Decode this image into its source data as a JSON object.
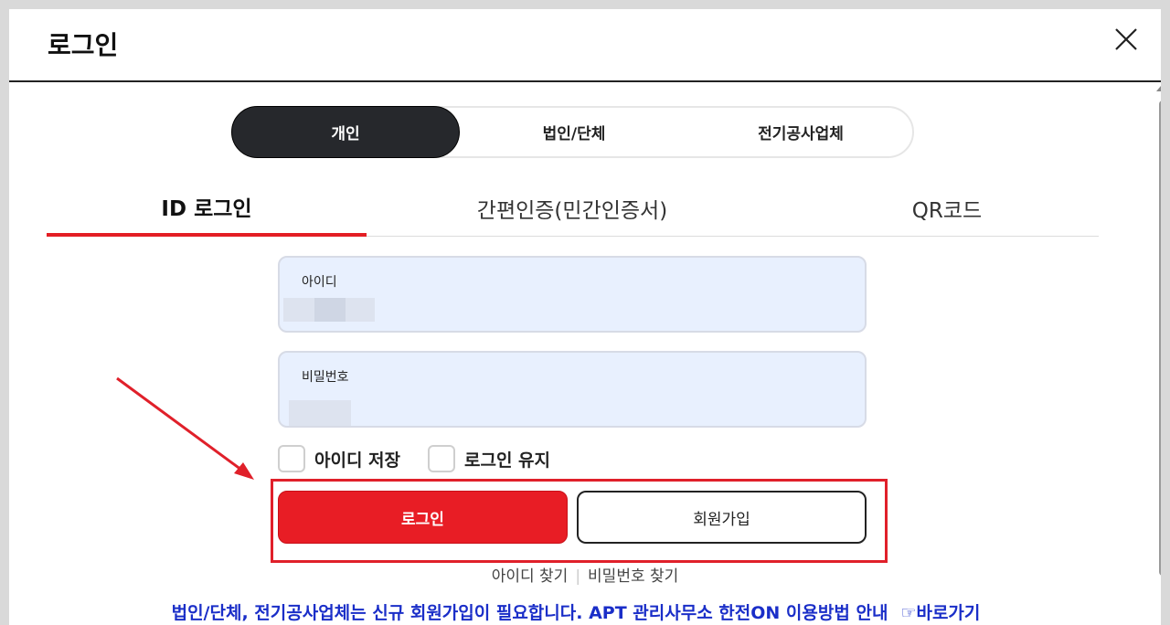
{
  "modal": {
    "title": "로그인"
  },
  "member_type": {
    "items": [
      {
        "label": "개인",
        "active": true
      },
      {
        "label": "법인/단체",
        "active": false
      },
      {
        "label": "전기공사업체",
        "active": false
      }
    ]
  },
  "login_tabs": [
    {
      "label": "ID 로그인",
      "active": true
    },
    {
      "label": "간편인증(민간인증서)",
      "active": false
    },
    {
      "label": "QR코드",
      "active": false
    }
  ],
  "fields": {
    "id_label": "아이디",
    "password_label": "비밀번호"
  },
  "options": {
    "save_id": "아이디 저장",
    "keep_login": "로그인 유지"
  },
  "buttons": {
    "login": "로그인",
    "join": "회원가입"
  },
  "find": {
    "find_id": "아이디 찾기",
    "separator": "|",
    "find_password": "비밀번호 찾기"
  },
  "notice": {
    "text": "법인/단체, 전기공사업체는 신규 회원가입이 필요합니다. APT 관리사무소 한전ON 이용방법 안내",
    "link": "☞바로가기"
  },
  "colors": {
    "accent_red": "#e81d25",
    "dark": "#26282c",
    "notice_blue": "#1a2ec8",
    "field_bg": "#e8f0fe"
  }
}
